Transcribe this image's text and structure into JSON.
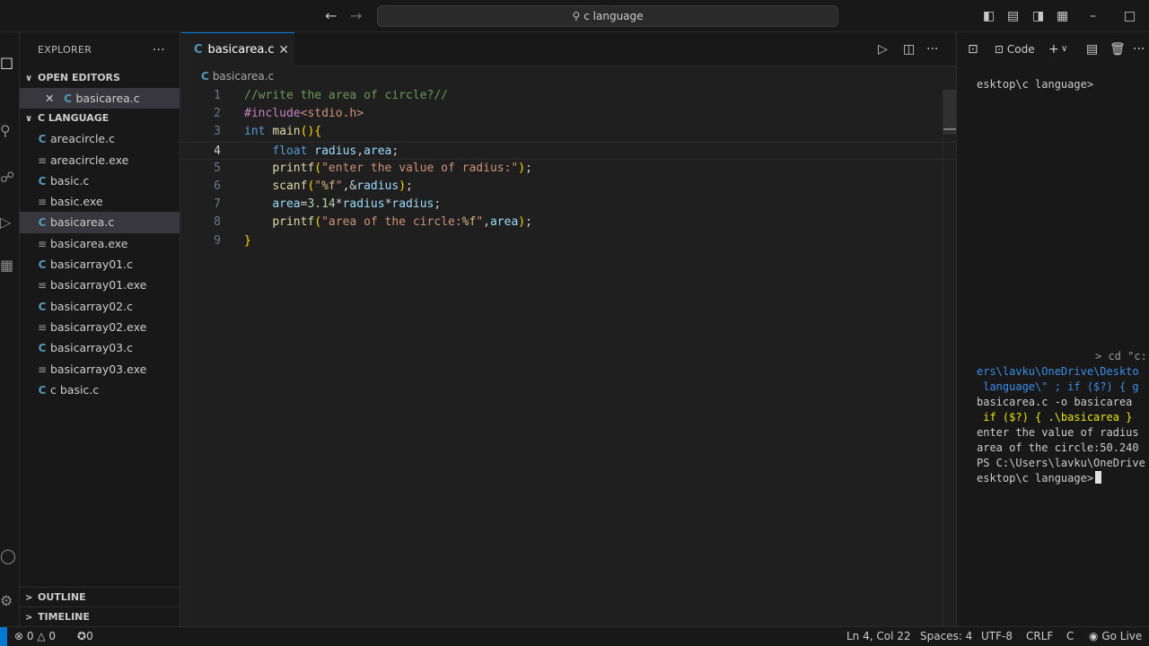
{
  "titlebar": {
    "search_text": "c language",
    "search_icon": "search-icon"
  },
  "explorer": {
    "title": "EXPLORER",
    "more": "···",
    "open_editors_label": "OPEN EDITORS",
    "open_editor_file": "basicarea.c",
    "folder_label": "C LANGUAGE",
    "files": [
      {
        "name": "areacircle.c",
        "type": "c"
      },
      {
        "name": "areacircle.exe",
        "type": "exe"
      },
      {
        "name": "basic.c",
        "type": "c"
      },
      {
        "name": "basic.exe",
        "type": "exe"
      },
      {
        "name": "basicarea.c",
        "type": "c",
        "selected": true
      },
      {
        "name": "basicarea.exe",
        "type": "exe"
      },
      {
        "name": "basicarray01.c",
        "type": "c"
      },
      {
        "name": "basicarray01.exe",
        "type": "exe"
      },
      {
        "name": "basicarray02.c",
        "type": "c"
      },
      {
        "name": "basicarray02.exe",
        "type": "exe"
      },
      {
        "name": "basicarray03.c",
        "type": "c"
      },
      {
        "name": "basicarray03.exe",
        "type": "exe"
      },
      {
        "name": "c basic.c",
        "type": "c"
      }
    ],
    "outline_label": "OUTLINE",
    "timeline_label": "TIMELINE"
  },
  "editor": {
    "tab_label": "basicarea.c",
    "tab_icon": "C",
    "breadcrumb": "basicarea.c",
    "current_line": 4,
    "lines": [
      "//write the area of circle?//",
      "#include<stdio.h>",
      "int main(){",
      "    float radius,area;",
      "    printf(\"enter the value of radius:\");",
      "    scanf(\"%f\",&radius);",
      "    area=3.14*radius*radius;",
      "    printf(\"area of the circle:%f\",area);",
      "}"
    ]
  },
  "panel": {
    "code_label": "Code",
    "terminal_lines": [
      "esktop\\c language>",
      "> cd \"c:",
      "ers\\lavku\\OneDrive\\Deskto",
      " language\\\" ; if ($?) { g",
      "basicarea.c -o basicarea",
      " if ($?) { .\\basicarea }",
      "enter the value of radius",
      "area of the circle:50.240",
      "PS C:\\Users\\lavku\\OneDrive",
      "esktop\\c language>"
    ]
  },
  "status": {
    "errors": "0",
    "warnings": "0",
    "ports": "0",
    "position": "Ln 4, Col 22",
    "spaces": "Spaces: 4",
    "encoding": "UTF-8",
    "eol": "CRLF",
    "language": "C",
    "go_live": "Go Live"
  },
  "colors": {
    "accent": "#0078d4",
    "c_icon": "#519aba",
    "background": "#1f1f1f",
    "sidebar": "#181818"
  }
}
